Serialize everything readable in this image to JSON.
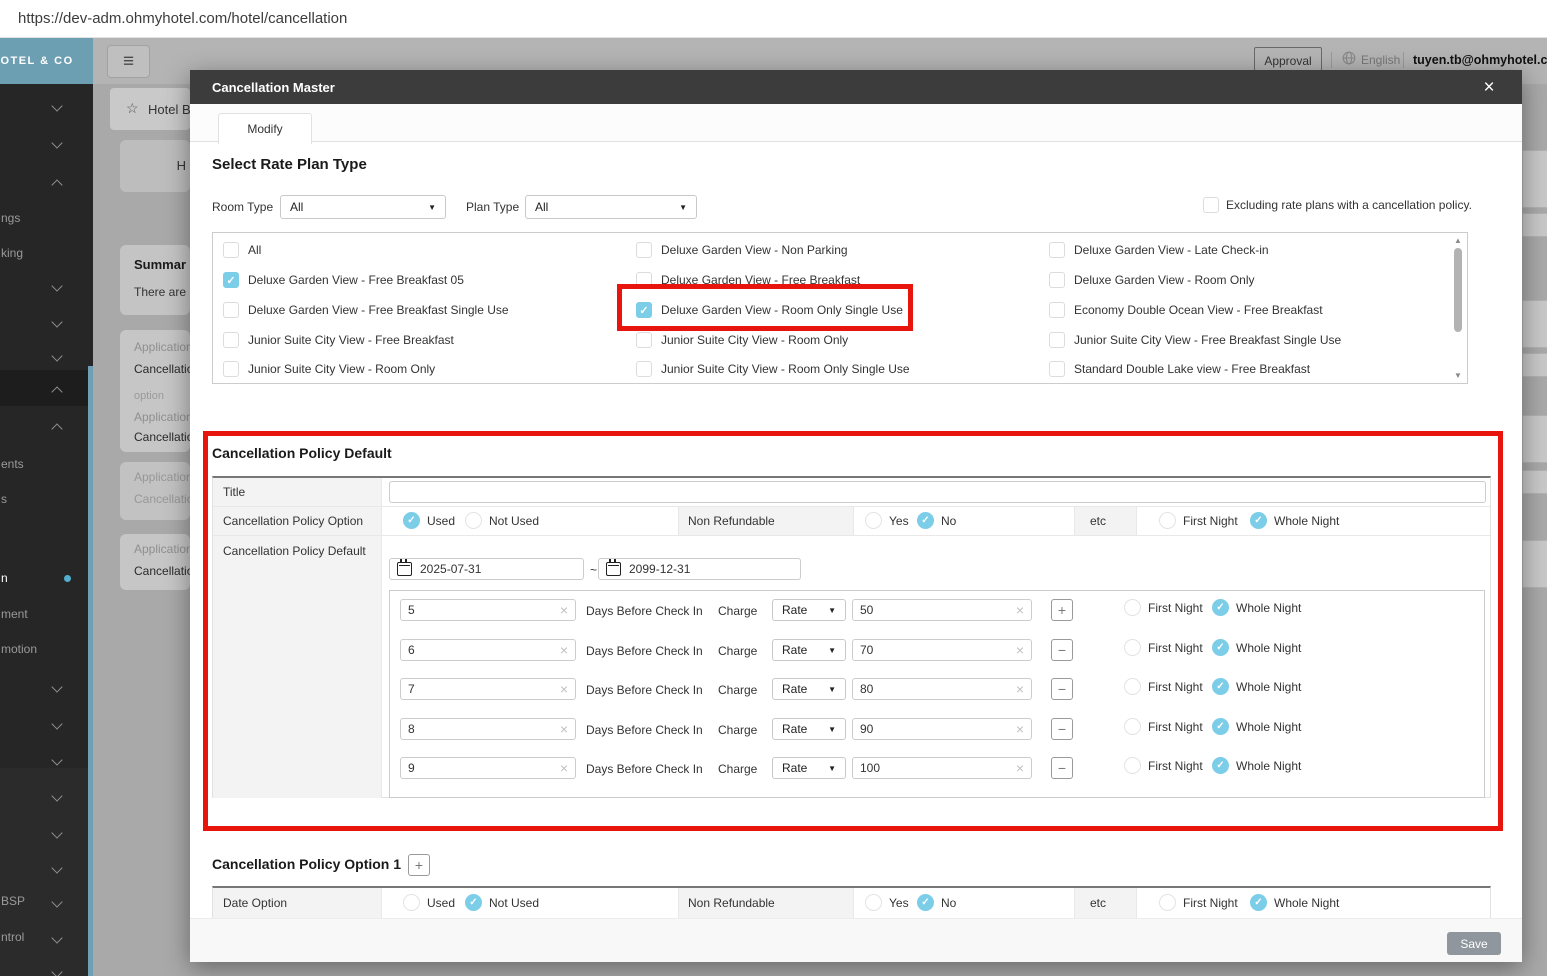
{
  "url": "https://dev-adm.ohmyhotel.com/hotel/cancellation",
  "topbar": {
    "approval": "Approval",
    "language": "English",
    "email": "tuyen.tb@ohmyhotel.com"
  },
  "sidebar": {
    "logo": "HOTEL & CO",
    "labels": {
      "l1": "ngs",
      "l2": "king",
      "l3": "ents",
      "l4": "s",
      "l5": "n",
      "l6": "ment",
      "l7": "motion",
      "l8": "BSP",
      "l9": "ntrol"
    }
  },
  "bg": {
    "breadcrumb": "Hotel B",
    "h_button": "H",
    "summary_title": "Summar",
    "summary_text": "There are",
    "card1": {
      "l1": "Application",
      "l2": "Cancellatio",
      "l3": "option",
      "l4": "Application",
      "l5": "Cancellatio"
    },
    "card2": {
      "l1": "Application",
      "l2": "Cancellatio"
    },
    "card3": {
      "l1": "Application",
      "l2": "Cancellatio"
    }
  },
  "modal": {
    "title": "Cancellation Master",
    "close": "×",
    "tab": "Modify",
    "select_heading": "Select Rate Plan Type",
    "room_type_label": "Room Type",
    "room_type_value": "All",
    "plan_type_label": "Plan Type",
    "plan_type_value": "All",
    "excluding": "Excluding rate plans with a cancellation policy.",
    "plans": {
      "col1": [
        {
          "label": "All",
          "checked": false
        },
        {
          "label": "Deluxe Garden View - Free Breakfast 05",
          "checked": true
        },
        {
          "label": "Deluxe Garden View - Free Breakfast Single Use",
          "checked": false
        },
        {
          "label": "Junior Suite City View - Free Breakfast",
          "checked": false
        },
        {
          "label": "Junior Suite City View - Room Only",
          "checked": false
        }
      ],
      "col2": [
        {
          "label": "Deluxe Garden View - Non Parking",
          "checked": false
        },
        {
          "label": "Deluxe Garden View - Free Breakfast",
          "checked": false
        },
        {
          "label": "Deluxe Garden View - Room Only Single Use",
          "checked": true
        },
        {
          "label": "Junior Suite City View - Room Only",
          "checked": false
        },
        {
          "label": "Junior Suite City View - Room Only Single Use",
          "checked": false
        }
      ],
      "col3": [
        {
          "label": "Deluxe Garden View - Late Check-in",
          "checked": false
        },
        {
          "label": "Deluxe Garden View - Room Only",
          "checked": false
        },
        {
          "label": "Economy Double Ocean View - Free Breakfast",
          "checked": false
        },
        {
          "label": "Junior Suite City View - Free Breakfast Single Use",
          "checked": false
        },
        {
          "label": "Standard Double Lake view - Free Breakfast",
          "checked": false
        }
      ]
    },
    "labels": {
      "used": "Used",
      "not_used": "Not Used",
      "non_refundable": "Non Refundable",
      "yes": "Yes",
      "no": "No",
      "etc": "etc",
      "first_night": "First Night",
      "whole_night": "Whole Night",
      "days_before": "Days Before Check In",
      "charge": "Charge",
      "tilde": "~"
    },
    "policy_default": {
      "heading": "Cancellation Policy Default",
      "title_label": "Title",
      "title_value": "",
      "option_label": "Cancellation Policy Option",
      "row_label": "Cancellation Policy Default",
      "date_from": "2025-07-31",
      "date_to": "2099-12-31",
      "rows": [
        {
          "days": "5",
          "rate": "Rate",
          "value": "50",
          "action": "+"
        },
        {
          "days": "6",
          "rate": "Rate",
          "value": "70",
          "action": "−"
        },
        {
          "days": "7",
          "rate": "Rate",
          "value": "80",
          "action": "−"
        },
        {
          "days": "8",
          "rate": "Rate",
          "value": "90",
          "action": "−"
        },
        {
          "days": "9",
          "rate": "Rate",
          "value": "100",
          "action": "−"
        }
      ]
    },
    "policy_option1": {
      "heading": "Cancellation Policy Option 1",
      "add": "+",
      "row_label": "Date Option"
    },
    "save": "Save"
  },
  "colors": {
    "accent_blue": "#7ccde8",
    "annotation_red": "#e8150d",
    "sidebar_teal": "#6d9fb3",
    "modal_header": "#3c3c3c"
  }
}
